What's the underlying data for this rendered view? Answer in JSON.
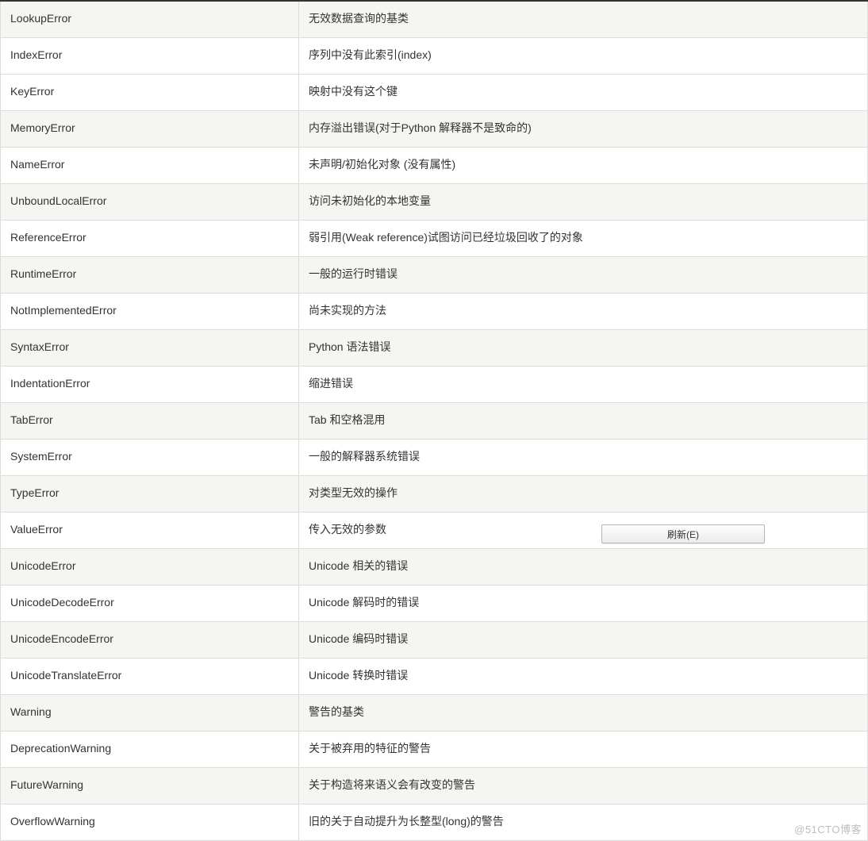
{
  "rows": [
    {
      "name": "LookupError",
      "desc": "无效数据查询的基类"
    },
    {
      "name": "IndexError",
      "desc": "序列中没有此索引(index)"
    },
    {
      "name": "KeyError",
      "desc": "映射中没有这个键"
    },
    {
      "name": "MemoryError",
      "desc": "内存溢出错误(对于Python 解释器不是致命的)"
    },
    {
      "name": "NameError",
      "desc": "未声明/初始化对象 (没有属性)"
    },
    {
      "name": "UnboundLocalError",
      "desc": "访问未初始化的本地变量"
    },
    {
      "name": "ReferenceError",
      "desc": "弱引用(Weak reference)试图访问已经垃圾回收了的对象"
    },
    {
      "name": "RuntimeError",
      "desc": "一般的运行时错误"
    },
    {
      "name": "NotImplementedError",
      "desc": "尚未实现的方法"
    },
    {
      "name": "SyntaxError",
      "desc": "Python 语法错误"
    },
    {
      "name": "IndentationError",
      "desc": "缩进错误"
    },
    {
      "name": "TabError",
      "desc": "Tab 和空格混用"
    },
    {
      "name": "SystemError",
      "desc": "一般的解释器系统错误"
    },
    {
      "name": "TypeError",
      "desc": "对类型无效的操作"
    },
    {
      "name": "ValueError",
      "desc": "传入无效的参数"
    },
    {
      "name": "UnicodeError",
      "desc": "Unicode 相关的错误"
    },
    {
      "name": "UnicodeDecodeError",
      "desc": "Unicode 解码时的错误"
    },
    {
      "name": "UnicodeEncodeError",
      "desc": "Unicode 编码时错误"
    },
    {
      "name": "UnicodeTranslateError",
      "desc": "Unicode 转换时错误"
    },
    {
      "name": "Warning",
      "desc": "警告的基类"
    },
    {
      "name": "DeprecationWarning",
      "desc": "关于被弃用的特征的警告"
    },
    {
      "name": "FutureWarning",
      "desc": "关于构造将来语义会有改变的警告"
    },
    {
      "name": "OverflowWarning",
      "desc": "旧的关于自动提升为长整型(long)的警告"
    }
  ],
  "alt_pattern": [
    1,
    0,
    0,
    1,
    0,
    1,
    0,
    1,
    0,
    1,
    0,
    1,
    0,
    1,
    0,
    1,
    0,
    1,
    0,
    1,
    0,
    1,
    0
  ],
  "context_menu": {
    "label": "刷新(E)"
  },
  "watermark": "@51CTO博客"
}
